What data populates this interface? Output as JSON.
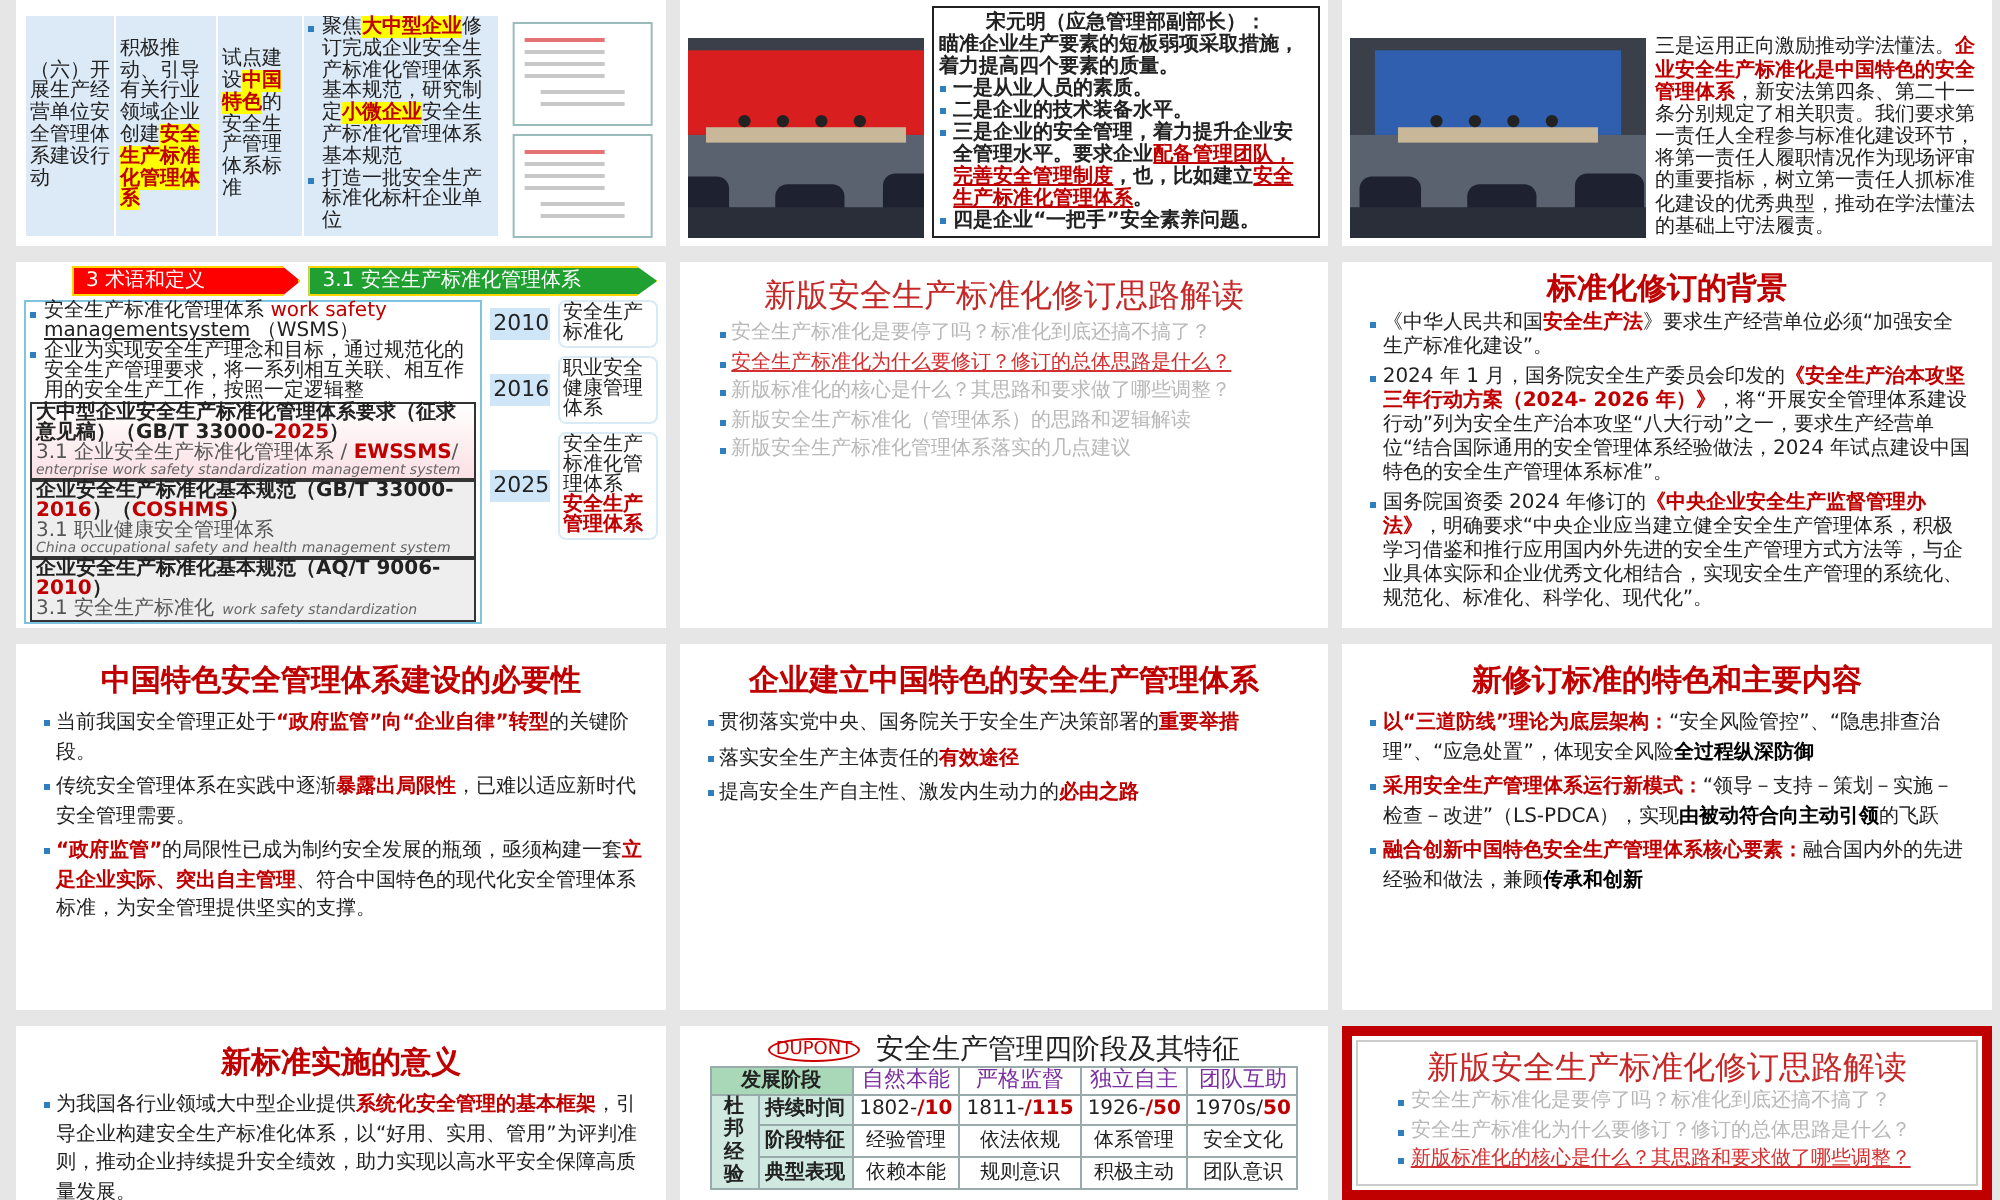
{
  "slides": [
    {
      "kind": "plan-table",
      "selected": false,
      "cells": [
        "（六）开展生产经营单位安全管理体系建设行动",
        "积极推动、引导有关行业领域企业创建**安全生产标准化管理体系**",
        "试点建设**中国特色**的安全生产管理体系标准"
      ],
      "tasks": [
        "聚焦**大中型企业**修订完成企业安全生产标准化管理体系基本规范，研究制定**小微企业**安全生产标准化管理体系基本规范",
        "打造一批安全生产标准化标杆企业单位"
      ]
    },
    {
      "kind": "photo-quote",
      "selected": false,
      "speaker": "宋元明（应急管理部副部长）：",
      "lead": "瞄准企业生产要素的短板弱项采取措施，着力提高四个要素的质量。",
      "points": [
        "一是从业人员的素质。",
        "二是企业的技术装备水平。",
        "三是企业的安全管理，着力提升企业安全管理水平。要求企业**配备管理团队，完善安全管理制度**，也，比如建立**安全生产标准化管理体系**。",
        "四是企业“一把手”安全素养问题。"
      ]
    },
    {
      "kind": "photo-text",
      "selected": false,
      "text": "三是运用正向激励推动学法懂法。**企业安全生产标准化是中国特色的安全管理体系**，新安法第四条、第二十一条分别规定了相关职责。我们要求第一责任人全程参与标准化建设环节，将第一责任人履职情况作为现场评审的重要指标，树立第一责任人抓标准化建设的优秀典型，推动在学法懂法的基础上守法履责。"
    },
    {
      "kind": "terms",
      "selected": false,
      "section": "3 术语和定义",
      "subsection": "3.1 安全生产标准化管理体系",
      "term": {
        "name": "安全生产标准化管理体系",
        "english": [
          "work safety",
          "managementsystem"
        ],
        "abbr": "（WSMS）"
      },
      "definition": "企业为实现安全生产理念和目标，通过规范化的安全生产管理要求，将一系列相互关联、相互作用的安全生产工作，按照一定逻辑整",
      "standards": [
        {
          "title": "大中型企业安全生产标准化管理体系要求（征求意见稿）（GB/T 33000-**2025**）",
          "definition": "3.1 企业安全生产标准化管理体系 / **EWSSMS**/",
          "english": "enterprise work safety standardization management system"
        },
        {
          "title": "企业安全生产标准化基本规范（GB/T 33000-**2016**）（**COSHMS**）",
          "definition": "3.1 职业健康安全管理体系",
          "english": "China occupational safety and health management system"
        },
        {
          "title": "企业安全生产标准化基本规范（AQ/T 9006-**2010**）",
          "definition": "3.1 安全生产标准化",
          "english": "work safety standardization"
        }
      ],
      "timeline": [
        {
          "year": "2010",
          "labels": [
            "安全生产标准化"
          ]
        },
        {
          "year": "2016",
          "labels": [
            "职业安全健康管理体系"
          ]
        },
        {
          "year": "2025",
          "labels": [
            "安全生产标准化管理体系",
            "安全生产管理体系"
          ]
        }
      ]
    },
    {
      "kind": "agenda",
      "selected": false,
      "title": "新版安全生产标准化修订思路解读",
      "items": [
        {
          "text": "安全生产标准化是要停了吗？标准化到底还搞不搞了？",
          "current": false
        },
        {
          "text": "安全生产标准化为什么要修订？修订的总体思路是什么？",
          "current": true
        },
        {
          "text": "新版标准化的核心是什么？其思路和要求做了哪些调整？",
          "current": false
        },
        {
          "text": "新版安全生产标准化（管理体系）的思路和逻辑解读",
          "current": false
        },
        {
          "text": "新版安全生产标准化管理体系落实的几点建议",
          "current": false
        }
      ]
    },
    {
      "kind": "bullets",
      "selected": false,
      "title": "标准化修订的背景",
      "bullets": [
        "《中华人民共和国**安全生产法**》要求生产经营单位必须“加强安全生产标准化建设”。",
        "2024 年 1 月，国务院安全生产委员会印发的**《安全生产治本攻坚三年行动方案（2024- 2026 年）》**，将“开展安全管理体系建设行动”列为安全生产治本攻坚“八大行动”之一，要求生产经营单位“结合国际通用的安全管理体系经验做法，2024 年试点建设中国特色的安全生产管理体系标准”。",
        "国务院国资委 2024 年修订的**《中央企业安全生产监督管理办法》**，明确要求“中央企业应当建立健全安全生产管理体系，积极学习借鉴和推行应用国内外先进的安全生产管理方式方法等，与企业具体实际和企业优秀文化相结合，实现安全生产管理的系统化、规范化、标准化、科学化、现代化”。"
      ]
    },
    {
      "kind": "bullets",
      "selected": false,
      "title": "中国特色安全管理体系建设的必要性",
      "bullets": [
        "当前我国安全管理正处于**“政府监管”向“企业自律”转型**的关键阶段。",
        "传统安全管理体系在实践中逐渐**暴露出局限性**，已难以适应新时代安全管理需要。",
        "**“政府监管”**的局限性已成为制约安全发展的瓶颈，亟须构建一套**立足企业实际、突出自主管理**、符合中国特色的现代化安全管理体系标准，为安全管理提供坚实的支撑。"
      ]
    },
    {
      "kind": "bullets",
      "selected": false,
      "title": "企业建立中国特色的安全生产管理体系",
      "bullets": [
        "贯彻落实党中央、国务院关于安全生产决策部署的**重要举措**",
        "落实安全生产主体责任的**有效途径**",
        "提高安全生产自主性、激发内生动力的**必由之路**"
      ]
    },
    {
      "kind": "lead-bullets",
      "selected": false,
      "title": "新修订标准的特色和主要内容",
      "bullets": [
        {
          "lead": "以“三道防线”理论为底层架构：",
          "text": "“安全风险管控”、“隐患排查治理”、“应急处置”，体现安全风险**全过程纵深防御**"
        },
        {
          "lead": "采用安全生产管理体系运行新模式：",
          "text": "“领导－支持－策划－实施－检查－改进”（LS-PDCA），实现**由被动符合向主动引领**的飞跃"
        },
        {
          "lead": "融合创新中国特色安全生产管理体系核心要素：",
          "text": "融合国内外的先进经验和做法，兼顾**传承和创新**"
        }
      ]
    },
    {
      "kind": "bullets",
      "selected": false,
      "title": "新标准实施的意义",
      "bullets": [
        "为我国各行业领域大中型企业提供**系统化安全管理的基本框架**，引导企业构建安全生产标准化体系，以“好用、实用、管用”为评判准则，推动企业持续提升安全绩效，助力实现以高水平安全保障高质量发展。"
      ]
    },
    {
      "kind": "stages-table",
      "selected": false,
      "logo": "DUPONT",
      "title": "安全生产管理四阶段及其特征",
      "corner": "发展阶段",
      "group": "杜邦经验",
      "stages": [
        "自然本能",
        "严格监督",
        "独立自主",
        "团队互助"
      ],
      "rows": [
        {
          "label": "持续时间",
          "cells": [
            "1802-**/10**",
            "1811-**/115**",
            "1926-**/50**",
            "1970s/**50**"
          ]
        },
        {
          "label": "阶段特征",
          "cells": [
            "经验管理",
            "依法依规",
            "体系管理",
            "安全文化"
          ]
        },
        {
          "label": "典型表现",
          "cells": [
            "依赖本能",
            "规则意识",
            "积极主动",
            "团队意识"
          ]
        }
      ]
    },
    {
      "kind": "agenda",
      "selected": true,
      "title": "新版安全生产标准化修订思路解读",
      "items": [
        {
          "text": "安全生产标准化是要停了吗？标准化到底还搞不搞了？",
          "current": false
        },
        {
          "text": "安全生产标准化为什么要修订？修订的总体思路是什么？",
          "current": false
        },
        {
          "text": "新版标准化的核心是什么？其思路和要求做了哪些调整？",
          "current": true
        }
      ]
    }
  ]
}
